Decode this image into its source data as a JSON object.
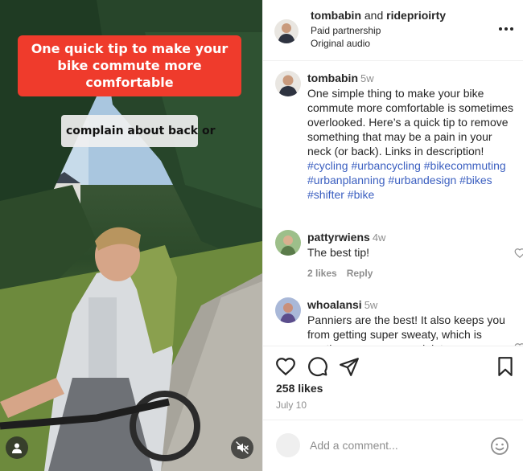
{
  "video": {
    "caption_red": "One quick tip to make your bike commute more comfortable",
    "caption_white": "complain about back or",
    "user_tag_icon": "user-icon",
    "mute_icon": "muted-speaker-icon"
  },
  "header": {
    "author": "tombabin",
    "joiner": " and ",
    "partner": "rideprioirty",
    "partnership_label": "Paid partnership",
    "audio_label": "Original audio",
    "more_icon": "more-horizontal-icon"
  },
  "caption": {
    "username": "tombabin",
    "age": "5w",
    "text": "One simple thing to make your bike commute more comfortable is sometimes overlooked. Here’s a quick tip to remove something that may be a pain in your neck (or back). Links in description!",
    "hashtags": "#cycling #urbancycling #bikecommuting #urbanplanning #urbandesign #bikes #shifter #bike"
  },
  "comments": [
    {
      "username": "pattyrwiens",
      "age": "4w",
      "text": "The best tip!",
      "likes": "2 likes",
      "reply": "Reply"
    },
    {
      "username": "whoalansi",
      "age": "5w",
      "text": "Panniers are the best! It also keeps you from getting super sweaty, which is another common complaint"
    }
  ],
  "actions": {
    "like_icon": "heart-icon",
    "comment_icon": "comment-icon",
    "share_icon": "send-icon",
    "save_icon": "bookmark-icon",
    "likes": "258 likes",
    "date": "July 10"
  },
  "composer": {
    "placeholder": "Add a comment...",
    "emoji_icon": "emoji-icon"
  },
  "colors": {
    "caption_red": "#ef3b2c",
    "hashtag_blue": "#3b5fc0",
    "muted_text": "#8e8e8e"
  }
}
